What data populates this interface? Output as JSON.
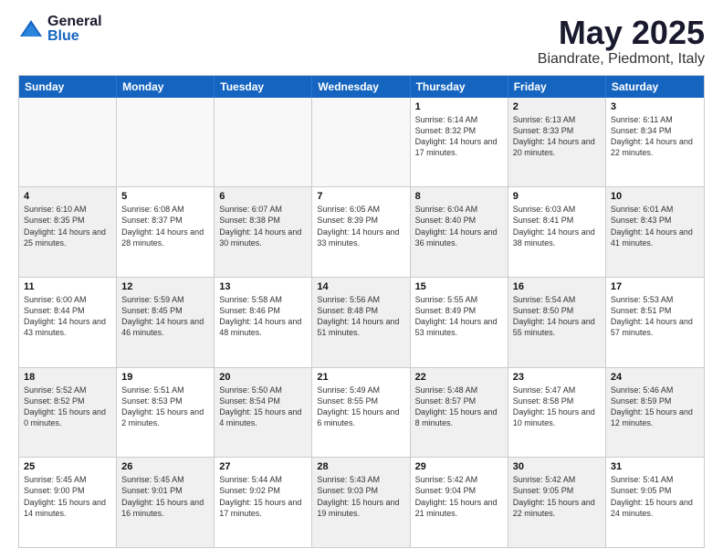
{
  "logo": {
    "general": "General",
    "blue": "Blue"
  },
  "header": {
    "title": "May 2025",
    "subtitle": "Biandrate, Piedmont, Italy"
  },
  "days": [
    "Sunday",
    "Monday",
    "Tuesday",
    "Wednesday",
    "Thursday",
    "Friday",
    "Saturday"
  ],
  "rows": [
    [
      {
        "day": "",
        "info": "",
        "shaded": true,
        "empty": true
      },
      {
        "day": "",
        "info": "",
        "shaded": true,
        "empty": true
      },
      {
        "day": "",
        "info": "",
        "shaded": true,
        "empty": true
      },
      {
        "day": "",
        "info": "",
        "shaded": true,
        "empty": true
      },
      {
        "day": "1",
        "info": "Sunrise: 6:14 AM\nSunset: 8:32 PM\nDaylight: 14 hours\nand 17 minutes."
      },
      {
        "day": "2",
        "info": "Sunrise: 6:13 AM\nSunset: 8:33 PM\nDaylight: 14 hours\nand 20 minutes.",
        "shaded": true
      },
      {
        "day": "3",
        "info": "Sunrise: 6:11 AM\nSunset: 8:34 PM\nDaylight: 14 hours\nand 22 minutes."
      }
    ],
    [
      {
        "day": "4",
        "info": "Sunrise: 6:10 AM\nSunset: 8:35 PM\nDaylight: 14 hours\nand 25 minutes.",
        "shaded": true
      },
      {
        "day": "5",
        "info": "Sunrise: 6:08 AM\nSunset: 8:37 PM\nDaylight: 14 hours\nand 28 minutes."
      },
      {
        "day": "6",
        "info": "Sunrise: 6:07 AM\nSunset: 8:38 PM\nDaylight: 14 hours\nand 30 minutes.",
        "shaded": true
      },
      {
        "day": "7",
        "info": "Sunrise: 6:05 AM\nSunset: 8:39 PM\nDaylight: 14 hours\nand 33 minutes."
      },
      {
        "day": "8",
        "info": "Sunrise: 6:04 AM\nSunset: 8:40 PM\nDaylight: 14 hours\nand 36 minutes.",
        "shaded": true
      },
      {
        "day": "9",
        "info": "Sunrise: 6:03 AM\nSunset: 8:41 PM\nDaylight: 14 hours\nand 38 minutes."
      },
      {
        "day": "10",
        "info": "Sunrise: 6:01 AM\nSunset: 8:43 PM\nDaylight: 14 hours\nand 41 minutes.",
        "shaded": true
      }
    ],
    [
      {
        "day": "11",
        "info": "Sunrise: 6:00 AM\nSunset: 8:44 PM\nDaylight: 14 hours\nand 43 minutes."
      },
      {
        "day": "12",
        "info": "Sunrise: 5:59 AM\nSunset: 8:45 PM\nDaylight: 14 hours\nand 46 minutes.",
        "shaded": true
      },
      {
        "day": "13",
        "info": "Sunrise: 5:58 AM\nSunset: 8:46 PM\nDaylight: 14 hours\nand 48 minutes."
      },
      {
        "day": "14",
        "info": "Sunrise: 5:56 AM\nSunset: 8:48 PM\nDaylight: 14 hours\nand 51 minutes.",
        "shaded": true
      },
      {
        "day": "15",
        "info": "Sunrise: 5:55 AM\nSunset: 8:49 PM\nDaylight: 14 hours\nand 53 minutes."
      },
      {
        "day": "16",
        "info": "Sunrise: 5:54 AM\nSunset: 8:50 PM\nDaylight: 14 hours\nand 55 minutes.",
        "shaded": true
      },
      {
        "day": "17",
        "info": "Sunrise: 5:53 AM\nSunset: 8:51 PM\nDaylight: 14 hours\nand 57 minutes."
      }
    ],
    [
      {
        "day": "18",
        "info": "Sunrise: 5:52 AM\nSunset: 8:52 PM\nDaylight: 15 hours\nand 0 minutes.",
        "shaded": true
      },
      {
        "day": "19",
        "info": "Sunrise: 5:51 AM\nSunset: 8:53 PM\nDaylight: 15 hours\nand 2 minutes."
      },
      {
        "day": "20",
        "info": "Sunrise: 5:50 AM\nSunset: 8:54 PM\nDaylight: 15 hours\nand 4 minutes.",
        "shaded": true
      },
      {
        "day": "21",
        "info": "Sunrise: 5:49 AM\nSunset: 8:55 PM\nDaylight: 15 hours\nand 6 minutes."
      },
      {
        "day": "22",
        "info": "Sunrise: 5:48 AM\nSunset: 8:57 PM\nDaylight: 15 hours\nand 8 minutes.",
        "shaded": true
      },
      {
        "day": "23",
        "info": "Sunrise: 5:47 AM\nSunset: 8:58 PM\nDaylight: 15 hours\nand 10 minutes."
      },
      {
        "day": "24",
        "info": "Sunrise: 5:46 AM\nSunset: 8:59 PM\nDaylight: 15 hours\nand 12 minutes.",
        "shaded": true
      }
    ],
    [
      {
        "day": "25",
        "info": "Sunrise: 5:45 AM\nSunset: 9:00 PM\nDaylight: 15 hours\nand 14 minutes."
      },
      {
        "day": "26",
        "info": "Sunrise: 5:45 AM\nSunset: 9:01 PM\nDaylight: 15 hours\nand 16 minutes.",
        "shaded": true
      },
      {
        "day": "27",
        "info": "Sunrise: 5:44 AM\nSunset: 9:02 PM\nDaylight: 15 hours\nand 17 minutes."
      },
      {
        "day": "28",
        "info": "Sunrise: 5:43 AM\nSunset: 9:03 PM\nDaylight: 15 hours\nand 19 minutes.",
        "shaded": true
      },
      {
        "day": "29",
        "info": "Sunrise: 5:42 AM\nSunset: 9:04 PM\nDaylight: 15 hours\nand 21 minutes."
      },
      {
        "day": "30",
        "info": "Sunrise: 5:42 AM\nSunset: 9:05 PM\nDaylight: 15 hours\nand 22 minutes.",
        "shaded": true
      },
      {
        "day": "31",
        "info": "Sunrise: 5:41 AM\nSunset: 9:05 PM\nDaylight: 15 hours\nand 24 minutes."
      }
    ]
  ]
}
